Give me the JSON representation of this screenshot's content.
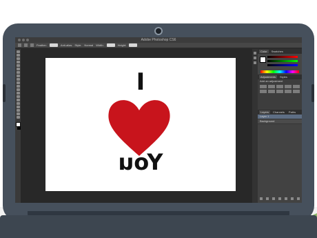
{
  "window": {
    "title": "Adobe Photoshop CS6"
  },
  "options_bar": {
    "feather_label": "Feather:",
    "feather_value": "0 px",
    "antialias_label": "Anti-alias",
    "style_label": "Style:",
    "style_value": "Normal",
    "width_label": "Width:",
    "height_label": "Height:"
  },
  "canvas": {
    "top_text": "I",
    "bottom_text": "You",
    "bottom_text_mirrored": true,
    "heart_color": "#c8141c",
    "background": "#ffffff"
  },
  "panels": {
    "color_tabs": [
      "Color",
      "Swatches"
    ],
    "adjustments_tabs": [
      "Adjustments",
      "Styles"
    ],
    "adjustments_label": "Add an adjustment",
    "layers_tabs": [
      "Layers",
      "Channels",
      "Paths"
    ],
    "layer_rows": [
      "Layer 1",
      "Background"
    ]
  },
  "colors": {
    "workspace": "#282828",
    "panel": "#3d3d3d",
    "laptop": "#46505c"
  }
}
